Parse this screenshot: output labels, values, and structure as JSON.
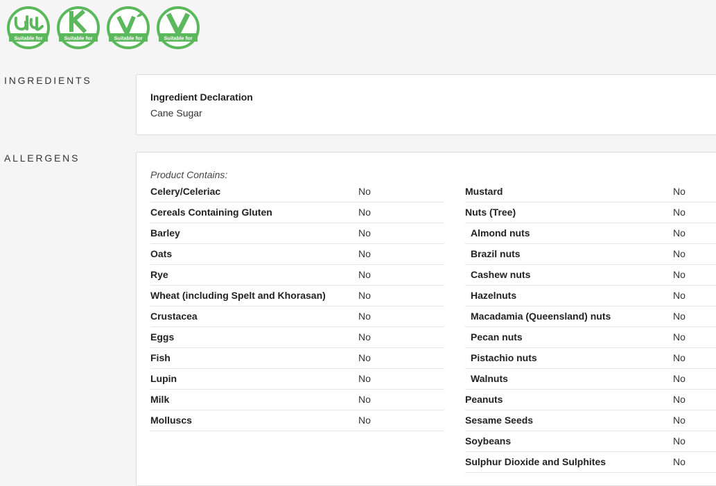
{
  "badges": [
    {
      "icon": "halal-icon",
      "caption": "Suitable for",
      "color": "#5cb85c"
    },
    {
      "icon": "kosher-icon",
      "caption": "Suitable for",
      "color": "#5cb85c"
    },
    {
      "icon": "vegetarian-icon",
      "caption": "Suitable for",
      "color": "#5cb85c"
    },
    {
      "icon": "vegan-icon",
      "caption": "Suitable for",
      "color": "#5cb85c"
    }
  ],
  "ingredients": {
    "label": "INGREDIENTS",
    "title": "Ingredient Declaration",
    "value": "Cane Sugar"
  },
  "allergens": {
    "label": "ALLERGENS",
    "contains": "Product Contains:",
    "left": [
      {
        "name": "Celery/Celeriac",
        "value": "No"
      },
      {
        "name": "Cereals Containing Gluten",
        "value": "No"
      },
      {
        "name": "Barley",
        "value": "No"
      },
      {
        "name": "Oats",
        "value": "No"
      },
      {
        "name": "Rye",
        "value": "No"
      },
      {
        "name": "Wheat (including Spelt and Khorasan)",
        "value": "No"
      },
      {
        "name": "Crustacea",
        "value": "No"
      },
      {
        "name": "Eggs",
        "value": "No"
      },
      {
        "name": "Fish",
        "value": "No"
      },
      {
        "name": "Lupin",
        "value": "No"
      },
      {
        "name": "Milk",
        "value": "No"
      },
      {
        "name": "Molluscs",
        "value": "No"
      }
    ],
    "right": [
      {
        "name": "Mustard",
        "value": "No",
        "sub": false
      },
      {
        "name": "Nuts (Tree)",
        "value": "No",
        "sub": false
      },
      {
        "name": "Almond nuts",
        "value": "No",
        "sub": true
      },
      {
        "name": "Brazil nuts",
        "value": "No",
        "sub": true
      },
      {
        "name": "Cashew nuts",
        "value": "No",
        "sub": true
      },
      {
        "name": "Hazelnuts",
        "value": "No",
        "sub": true
      },
      {
        "name": "Macadamia (Queensland) nuts",
        "value": "No",
        "sub": true
      },
      {
        "name": "Pecan nuts",
        "value": "No",
        "sub": true
      },
      {
        "name": "Pistachio nuts",
        "value": "No",
        "sub": true
      },
      {
        "name": "Walnuts",
        "value": "No",
        "sub": true
      },
      {
        "name": "Peanuts",
        "value": "No",
        "sub": false
      },
      {
        "name": "Sesame Seeds",
        "value": "No",
        "sub": false
      },
      {
        "name": "Soybeans",
        "value": "No",
        "sub": false
      },
      {
        "name": "Sulphur Dioxide and Sulphites",
        "value": "No",
        "sub": false
      }
    ]
  }
}
